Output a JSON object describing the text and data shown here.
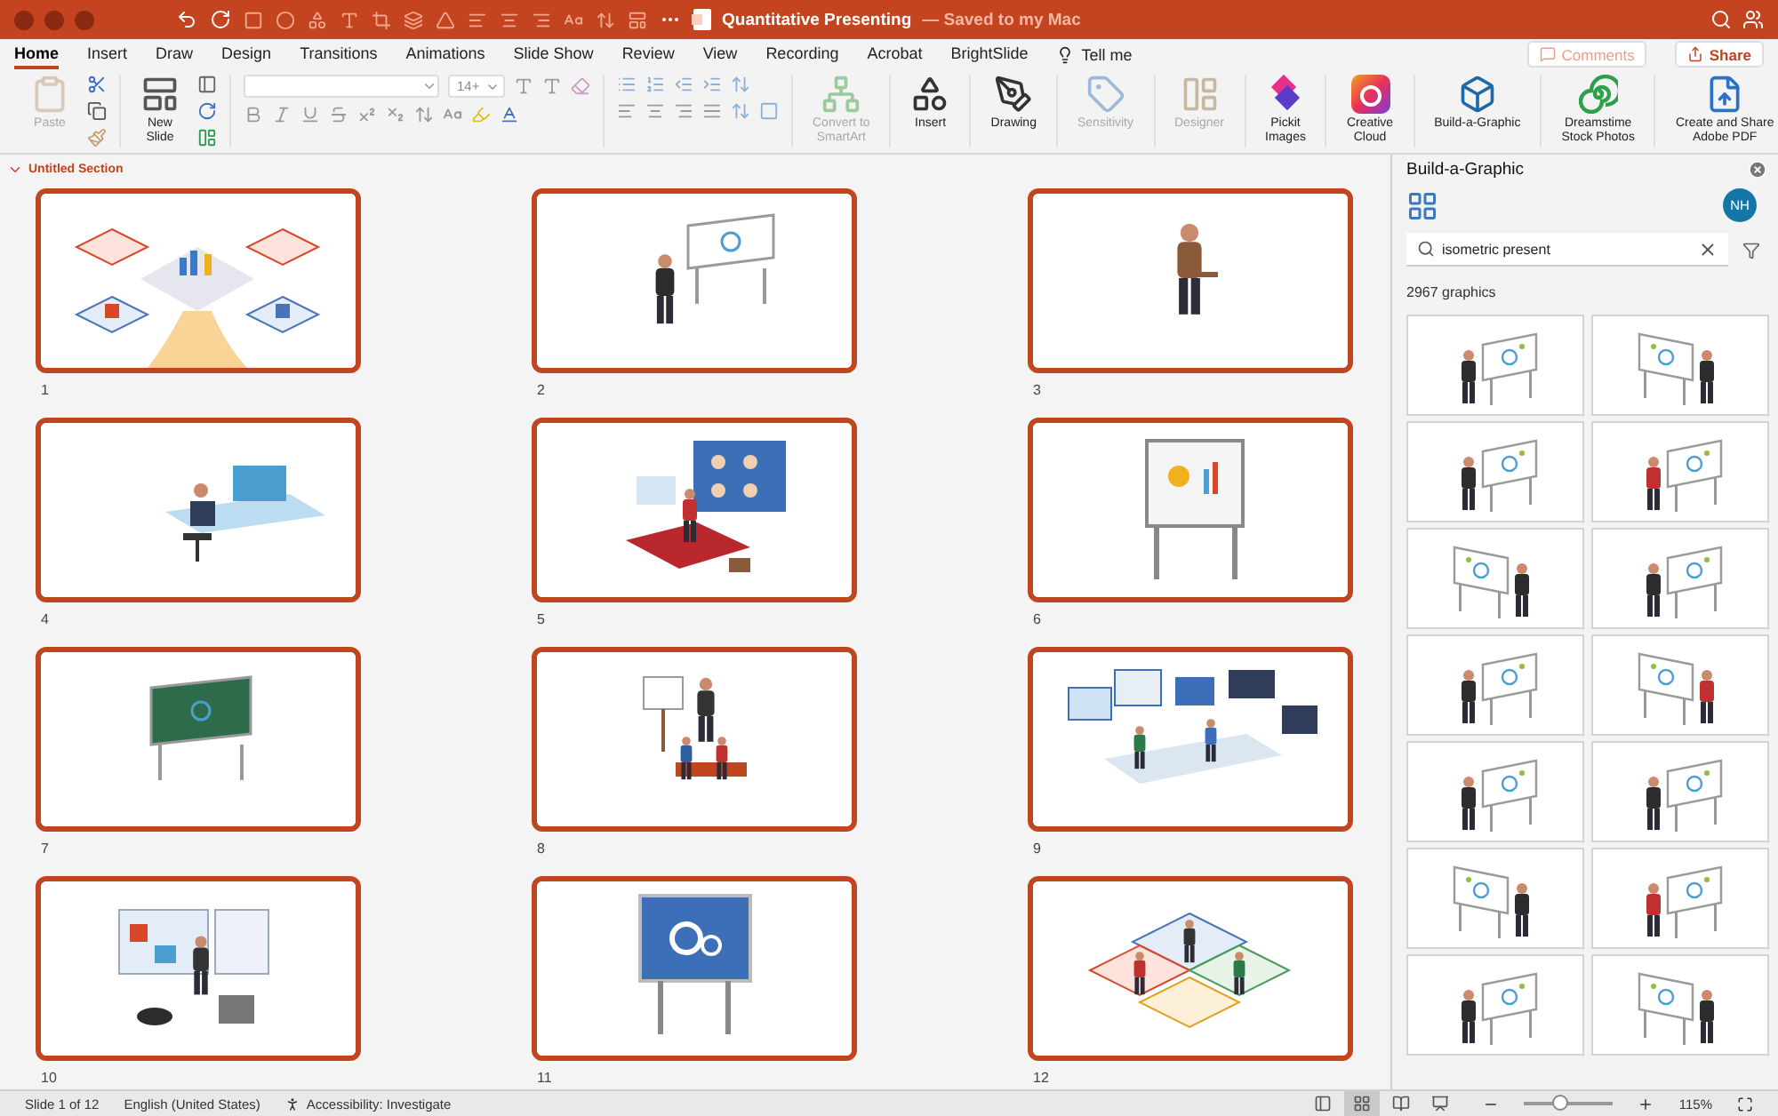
{
  "window": {
    "title": "Quantitative Presenting",
    "status": "— Saved to my Mac"
  },
  "tabs": [
    {
      "label": "Home",
      "selected": true
    },
    {
      "label": "Insert",
      "selected": false
    },
    {
      "label": "Draw",
      "selected": false
    },
    {
      "label": "Design",
      "selected": false
    },
    {
      "label": "Transitions",
      "selected": false
    },
    {
      "label": "Animations",
      "selected": false
    },
    {
      "label": "Slide Show",
      "selected": false
    },
    {
      "label": "Review",
      "selected": false
    },
    {
      "label": "View",
      "selected": false
    },
    {
      "label": "Recording",
      "selected": false
    },
    {
      "label": "Acrobat",
      "selected": false
    },
    {
      "label": "BrightSlide",
      "selected": false
    }
  ],
  "tell_me": "Tell me",
  "comments": "Comments",
  "share": "Share",
  "ribbon": {
    "paste": "Paste",
    "new_slide": "New\nSlide",
    "font_size": "14+",
    "big_buttons": [
      {
        "kind": "smartart",
        "label": "Convert to\nSmartArt",
        "disabled": true
      },
      {
        "kind": "insert",
        "label": "Insert",
        "disabled": false
      },
      {
        "kind": "drawing",
        "label": "Drawing",
        "disabled": false
      },
      {
        "kind": "sensitivity",
        "label": "Sensitivity",
        "disabled": true
      },
      {
        "kind": "designer",
        "label": "Designer",
        "disabled": true
      },
      {
        "kind": "pickit",
        "label": "Pickit\nImages",
        "disabled": false
      },
      {
        "kind": "cloud",
        "label": "Creative\nCloud",
        "disabled": false
      },
      {
        "kind": "cube",
        "label": "Build-a-Graphic",
        "disabled": false
      },
      {
        "kind": "spiral",
        "label": "Dreamstime\nStock Photos",
        "disabled": false
      },
      {
        "kind": "pdf",
        "label": "Create and Share\nAdobe PDF",
        "disabled": false
      }
    ]
  },
  "section": {
    "title": "Untitled Section",
    "expanded": true
  },
  "slides": [
    {
      "number": "1"
    },
    {
      "number": "2"
    },
    {
      "number": "3"
    },
    {
      "number": "4"
    },
    {
      "number": "5"
    },
    {
      "number": "6"
    },
    {
      "number": "7"
    },
    {
      "number": "8"
    },
    {
      "number": "9"
    },
    {
      "number": "10"
    },
    {
      "number": "11"
    },
    {
      "number": "12"
    }
  ],
  "panel": {
    "title": "Build-a-Graphic",
    "avatar": "NH",
    "search": "isometric present",
    "count": "2967 graphics"
  },
  "status": {
    "slide": "Slide 1 of 12",
    "language": "English (United States)",
    "accessibility": "Accessibility: Investigate",
    "views": [
      {
        "kind": "normal",
        "selected": false
      },
      {
        "kind": "sorter",
        "selected": true
      },
      {
        "kind": "reading",
        "selected": false
      },
      {
        "kind": "show",
        "selected": false
      }
    ],
    "zoom": {
      "level": 0.4,
      "reading": "115%"
    }
  }
}
